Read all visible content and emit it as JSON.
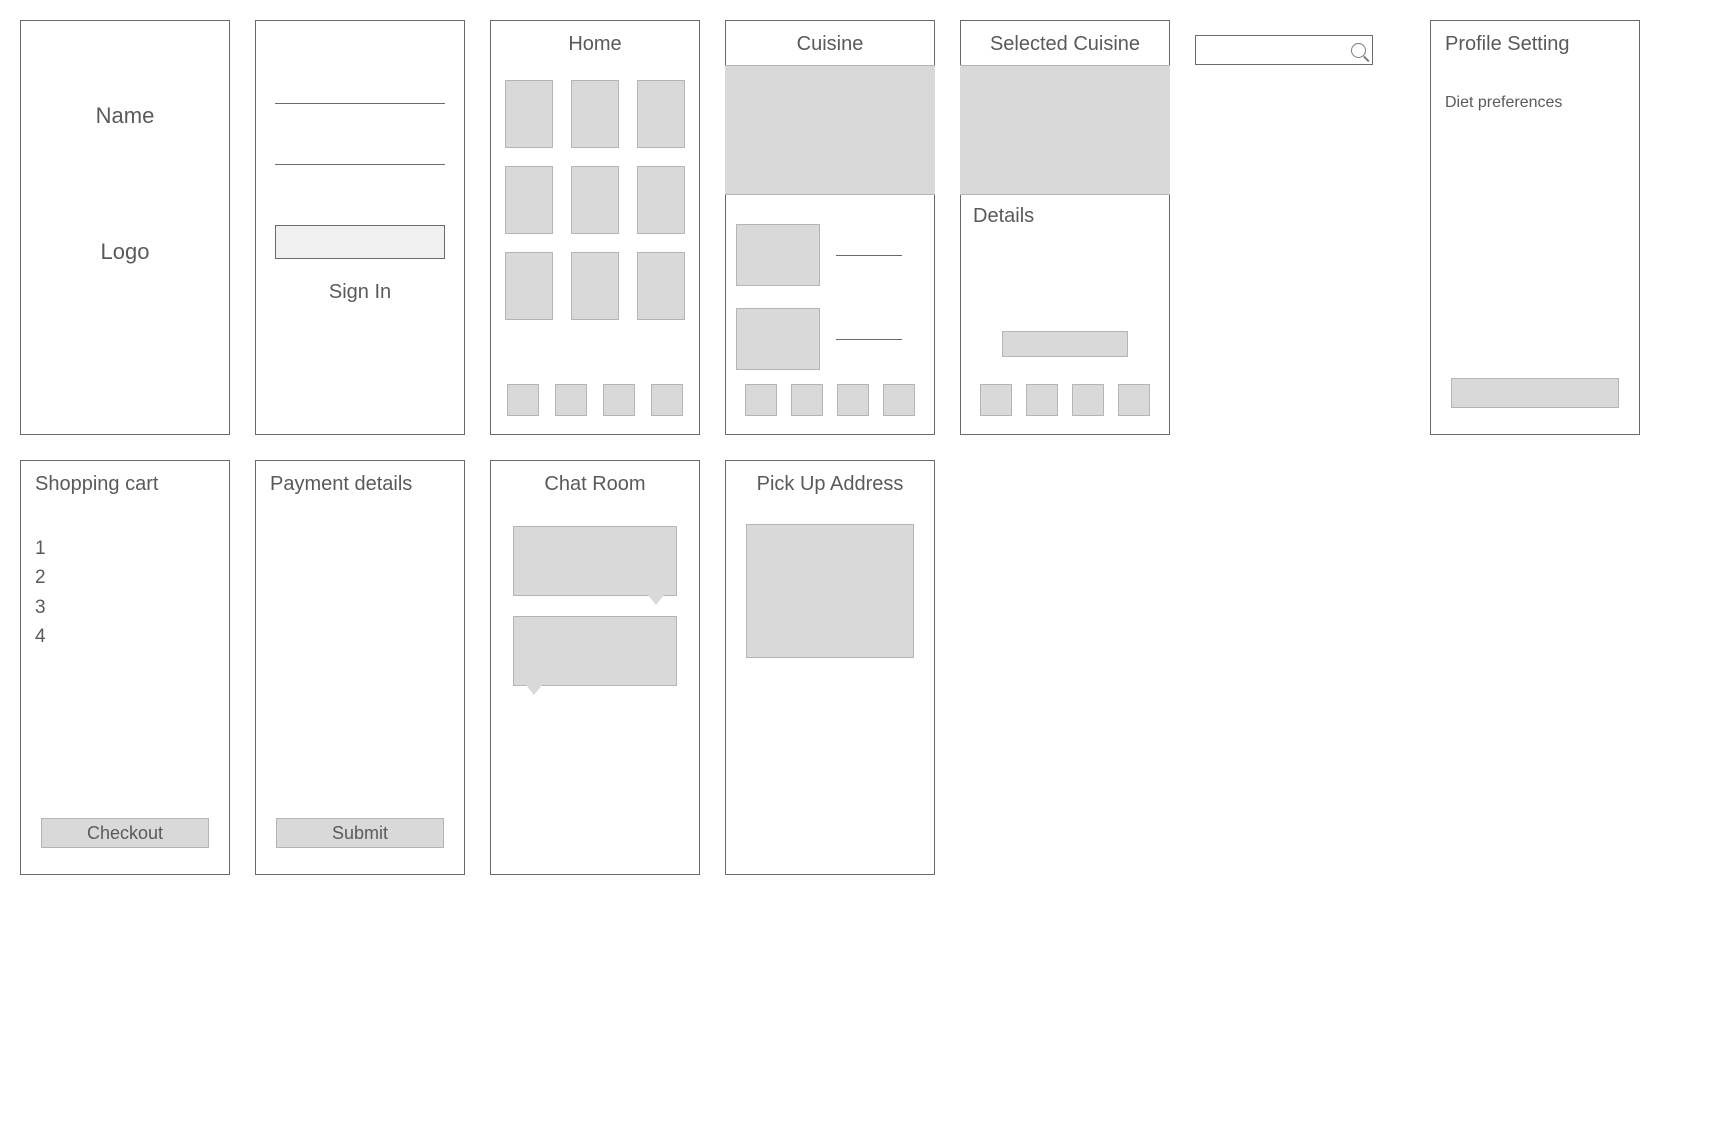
{
  "panels": {
    "branding": {
      "name": "Name",
      "logo": "Logo"
    },
    "signin": {
      "label": "Sign In"
    },
    "home": {
      "title": "Home"
    },
    "cuisine": {
      "title": "Cuisine"
    },
    "selected": {
      "title": "Selected Cuisine",
      "details": "Details"
    },
    "profile": {
      "title": "Profile Setting",
      "diet": "Diet preferences"
    },
    "cart": {
      "title": "Shopping cart",
      "items": [
        "1",
        "2",
        "3",
        "4"
      ],
      "checkout": "Checkout"
    },
    "payment": {
      "title": "Payment details",
      "submit": "Submit"
    },
    "chat": {
      "title": "Chat Room"
    },
    "pickup": {
      "title": "Pick Up Address"
    }
  }
}
